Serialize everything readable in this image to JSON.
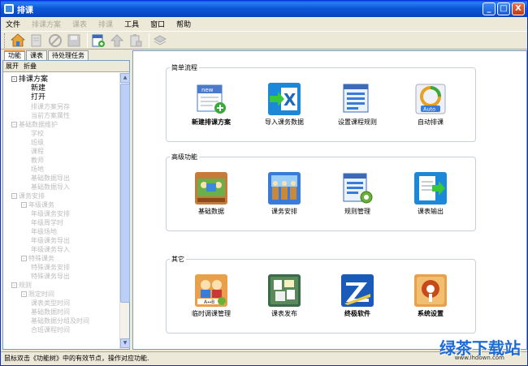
{
  "window": {
    "title": "排课"
  },
  "title_controls": {
    "minimize": "_",
    "maximize": "□",
    "close": "X"
  },
  "menu": [
    {
      "label": "文件",
      "enabled": true
    },
    {
      "label": "排课方案",
      "enabled": false
    },
    {
      "label": "课表",
      "enabled": false
    },
    {
      "label": "排课",
      "enabled": false
    },
    {
      "label": "工具",
      "enabled": true
    },
    {
      "label": "窗口",
      "enabled": true
    },
    {
      "label": "帮助",
      "enabled": true
    }
  ],
  "toolbar": [
    "home-icon",
    "document-icon",
    "stop-icon",
    "save-icon",
    "new-schedule-icon",
    "auto-icon",
    "clipboard-icon",
    "layers-icon"
  ],
  "left_tabs": [
    {
      "label": "功能",
      "active": true
    },
    {
      "label": "课表",
      "active": false
    },
    {
      "label": "待处理任务",
      "active": false
    }
  ],
  "tree_header": [
    "展开",
    "折叠"
  ],
  "tree": [
    {
      "label": "排课方案",
      "level": 0,
      "toggle": "-",
      "active": true
    },
    {
      "label": "新建",
      "level": 2,
      "toggle": "",
      "active": true
    },
    {
      "label": "打开",
      "level": 2,
      "toggle": "",
      "active": true
    },
    {
      "label": "排课方案另存",
      "level": 2,
      "toggle": "",
      "active": false
    },
    {
      "label": "当前方案属性",
      "level": 2,
      "toggle": "",
      "active": false
    },
    {
      "label": "基础数据维护",
      "level": 0,
      "toggle": "-",
      "active": false
    },
    {
      "label": "学校",
      "level": 2,
      "toggle": "",
      "active": false
    },
    {
      "label": "班级",
      "level": 2,
      "toggle": "",
      "active": false
    },
    {
      "label": "课程",
      "level": 2,
      "toggle": "",
      "active": false
    },
    {
      "label": "教师",
      "level": 2,
      "toggle": "",
      "active": false
    },
    {
      "label": "场地",
      "level": 2,
      "toggle": "",
      "active": false
    },
    {
      "label": "基础数据导出",
      "level": 2,
      "toggle": "",
      "active": false
    },
    {
      "label": "基础数据导入",
      "level": 2,
      "toggle": "",
      "active": false
    },
    {
      "label": "课务安排",
      "level": 0,
      "toggle": "-",
      "active": false
    },
    {
      "label": "年级课务",
      "level": 1,
      "toggle": "-",
      "active": false
    },
    {
      "label": "年级课务安排",
      "level": 2,
      "toggle": "",
      "active": false
    },
    {
      "label": "年级周学时",
      "level": 2,
      "toggle": "",
      "active": false
    },
    {
      "label": "年级场地",
      "level": 2,
      "toggle": "",
      "active": false
    },
    {
      "label": "年级课务导出",
      "level": 2,
      "toggle": "",
      "active": false
    },
    {
      "label": "年级课务导入",
      "level": 2,
      "toggle": "",
      "active": false
    },
    {
      "label": "特殊课务",
      "level": 1,
      "toggle": "-",
      "active": false
    },
    {
      "label": "特殊课务安排",
      "level": 2,
      "toggle": "",
      "active": false
    },
    {
      "label": "特殊课务导出",
      "level": 2,
      "toggle": "",
      "active": false
    },
    {
      "label": "规则",
      "level": 0,
      "toggle": "-",
      "active": false
    },
    {
      "label": "限定时间",
      "level": 1,
      "toggle": "-",
      "active": false
    },
    {
      "label": "课表类型时间",
      "level": 2,
      "toggle": "",
      "active": false
    },
    {
      "label": "基础数据时间",
      "level": 2,
      "toggle": "",
      "active": false
    },
    {
      "label": "基础数据分组及时间",
      "level": 2,
      "toggle": "",
      "active": false
    },
    {
      "label": "合班课程时间",
      "level": 2,
      "toggle": "",
      "active": false
    }
  ],
  "groups": [
    {
      "title": "简单流程",
      "items": [
        {
          "label": "新建排课方案",
          "icon": "new-schedule-icon",
          "bold": true
        },
        {
          "label": "导入课务数据",
          "icon": "excel-import-icon",
          "bold": false
        },
        {
          "label": "设置课程规则",
          "icon": "list-settings-icon",
          "bold": false
        },
        {
          "label": "自动排课",
          "icon": "auto-schedule-icon",
          "bold": false
        }
      ]
    },
    {
      "title": "高级功能",
      "items": [
        {
          "label": "基础数据",
          "icon": "base-data-icon",
          "bold": false
        },
        {
          "label": "课务安排",
          "icon": "course-arrange-icon",
          "bold": false
        },
        {
          "label": "规则管理",
          "icon": "rule-manage-icon",
          "bold": false
        },
        {
          "label": "课表输出",
          "icon": "timetable-export-icon",
          "bold": false
        }
      ]
    },
    {
      "title": "其它",
      "items": [
        {
          "label": "临时调课管理",
          "icon": "temp-adjust-icon",
          "bold": false
        },
        {
          "label": "课表发布",
          "icon": "timetable-publish-icon",
          "bold": false
        },
        {
          "label": "终极软件",
          "icon": "brand-logo-icon",
          "bold": true
        },
        {
          "label": "系统设置",
          "icon": "system-settings-icon",
          "bold": true
        }
      ]
    }
  ],
  "status": "鼠标双击《功能树》中的有效节点，操作对应功能.",
  "watermark": {
    "text": "绿茶下载站",
    "sub": "www.lhdown.com"
  }
}
